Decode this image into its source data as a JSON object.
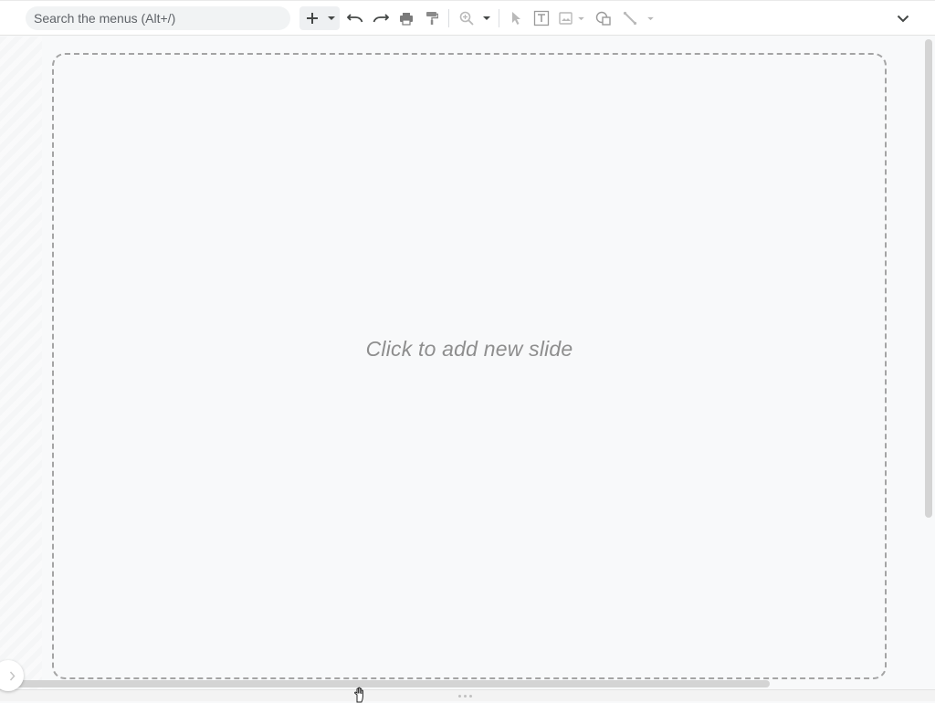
{
  "toolbar": {
    "search": {
      "placeholder": "Search the menus (Alt+/)"
    },
    "buttons": [
      {
        "name": "new-slide",
        "icon": "plus-icon"
      },
      {
        "name": "new-slide-dropdown",
        "icon": "caret-down-icon"
      },
      {
        "name": "undo",
        "icon": "undo-icon"
      },
      {
        "name": "redo",
        "icon": "redo-icon"
      },
      {
        "name": "print",
        "icon": "printer-icon"
      },
      {
        "name": "paint-format",
        "icon": "paint-roller-icon"
      },
      {
        "name": "zoom",
        "icon": "magnifier-icon"
      },
      {
        "name": "select",
        "icon": "pointer-icon"
      },
      {
        "name": "text-box",
        "icon": "text-box-icon"
      },
      {
        "name": "image",
        "icon": "image-icon"
      },
      {
        "name": "shape",
        "icon": "shape-icon"
      },
      {
        "name": "line",
        "icon": "line-icon"
      },
      {
        "name": "collapse-toolbar",
        "icon": "chevron-down-icon"
      }
    ]
  },
  "canvas": {
    "placeholder_text": "Click to add new slide"
  },
  "colors": {
    "background": "#f8f9fa",
    "icon_dark": "#444746",
    "icon_disabled": "#b9b9b9",
    "dashed_border": "#a4a4a4"
  }
}
